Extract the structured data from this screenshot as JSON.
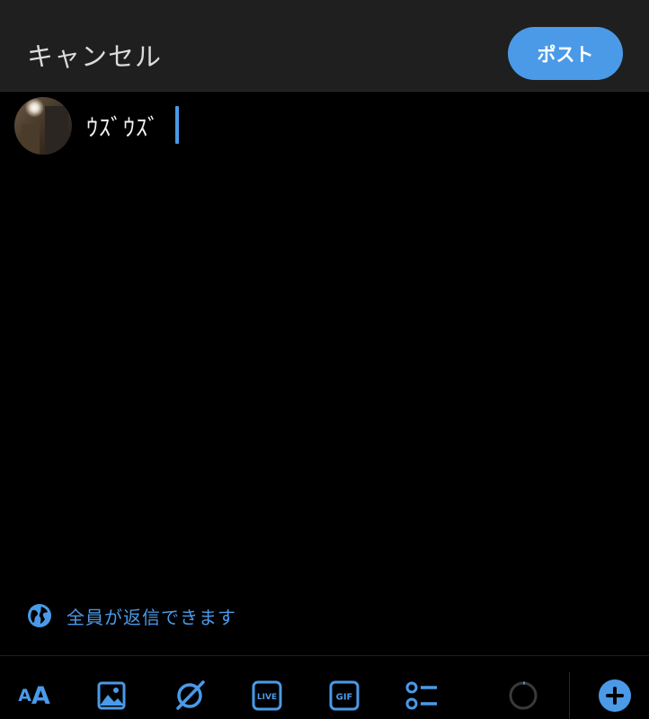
{
  "header": {
    "cancel_label": "キャンセル",
    "post_label": "ポスト"
  },
  "composer": {
    "text": "ｳｽﾞｳｽﾞ"
  },
  "reply_setting": {
    "label": "全員が返信できます",
    "icon": "globe-icon"
  },
  "toolbar": {
    "text_format": {
      "small": "A",
      "big": "A",
      "icon": "text-format-icon"
    },
    "items": [
      {
        "icon": "image-icon"
      },
      {
        "icon": "grok-icon"
      },
      {
        "icon": "live-icon",
        "label": "LIVE"
      },
      {
        "icon": "gif-icon",
        "label": "GIF"
      },
      {
        "icon": "poll-icon"
      },
      {
        "icon": "char-count-progress-icon"
      },
      {
        "icon": "add-post-icon"
      }
    ]
  },
  "colors": {
    "accent": "#4a9ae8",
    "header_bg": "#1f1f1f",
    "background": "#000000",
    "text": "#f2f2f2"
  }
}
